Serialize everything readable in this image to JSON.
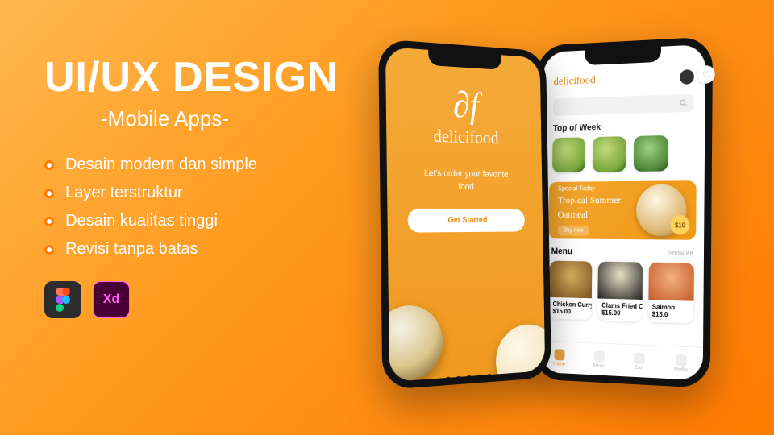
{
  "heading": "UI/UX DESIGN",
  "subtitle": "-Mobile Apps-",
  "bullets": [
    "Desain modern dan simple",
    "Layer terstruktur",
    "Desain kualitas tinggi",
    "Revisi tanpa batas"
  ],
  "tools": {
    "figma": "Figma",
    "xd": "Xd"
  },
  "front_phone": {
    "logo_mark": "∂f",
    "brand": "delicifood",
    "tagline_l1": "Let's order your favorite",
    "tagline_l2": "food.",
    "cta": "Get Started"
  },
  "back_phone": {
    "brand": "delicifood",
    "search_placeholder": "",
    "section_top": "Top of Week",
    "banner": {
      "pre": "Special Today",
      "title_l1": "Tropical Summer",
      "title_l2": "Oatmeal",
      "btn": "Buy now",
      "badge": "$10"
    },
    "menu": {
      "label": "Menu",
      "show_all": "Show All",
      "items": [
        {
          "name": "Chicken Curry",
          "price": "$15.00"
        },
        {
          "name": "Clams Fried Curry",
          "price": "$15.00"
        },
        {
          "name": "Salmon",
          "price": "$15.0"
        }
      ]
    },
    "tabs": [
      "Home",
      "Menu",
      "Cart",
      "Profile"
    ],
    "heart": "♡"
  }
}
